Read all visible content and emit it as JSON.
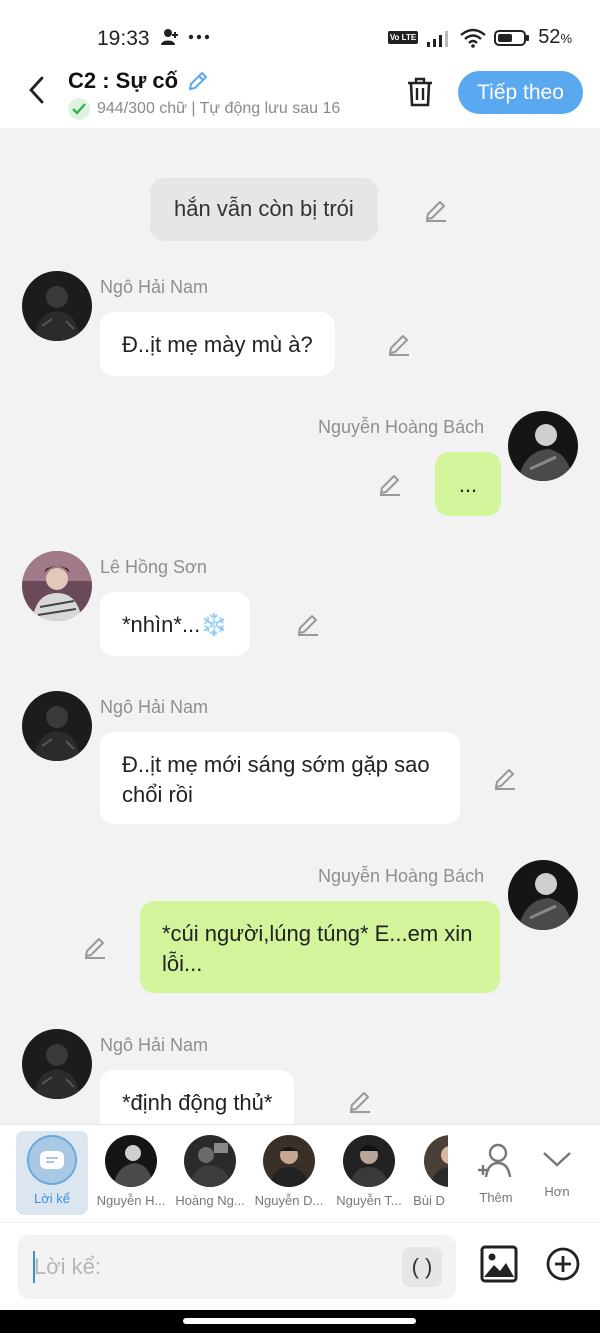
{
  "status_bar": {
    "time": "19:33",
    "network_badge": "Vo LTE",
    "battery": "52",
    "battery_unit": "%"
  },
  "header": {
    "title": "C2 : Sự cố",
    "subtitle": "944/300 chữ | Tự động lưu sau 16",
    "next_label": "Tiếp theo"
  },
  "messages": [
    {
      "type": "narration",
      "text": "hắn vẫn còn bị trói"
    },
    {
      "type": "left",
      "sender": "Ngô Hải Nam",
      "text": "Đ..ịt mẹ mày mù à?"
    },
    {
      "type": "right",
      "sender": "Nguyễn Hoàng Bách",
      "text": "..."
    },
    {
      "type": "left",
      "sender": "Lê Hồng Sơn",
      "text": "*nhìn*...",
      "emoji": "❄️"
    },
    {
      "type": "left",
      "sender": "Ngô Hải Nam",
      "text": "Đ..ịt mẹ mới sáng sớm gặp sao chổi rồi"
    },
    {
      "type": "right",
      "sender": "Nguyễn Hoàng Bách",
      "text": "*cúi người,lúng túng* E...em xin lỗi..."
    },
    {
      "type": "left",
      "sender": "Ngô Hải Nam",
      "text": "*định động thủ*"
    }
  ],
  "character_bar": {
    "narration_label": "Lời kể",
    "characters": [
      "Nguyễn H...",
      "Hoàng Ng...",
      "Nguyễn D...",
      "Nguyễn T...",
      "Bùi D"
    ],
    "more_label": "Thêm",
    "expand_label": "Hơn"
  },
  "input": {
    "placeholder": "Lời kể:",
    "paren_label": "( )"
  }
}
